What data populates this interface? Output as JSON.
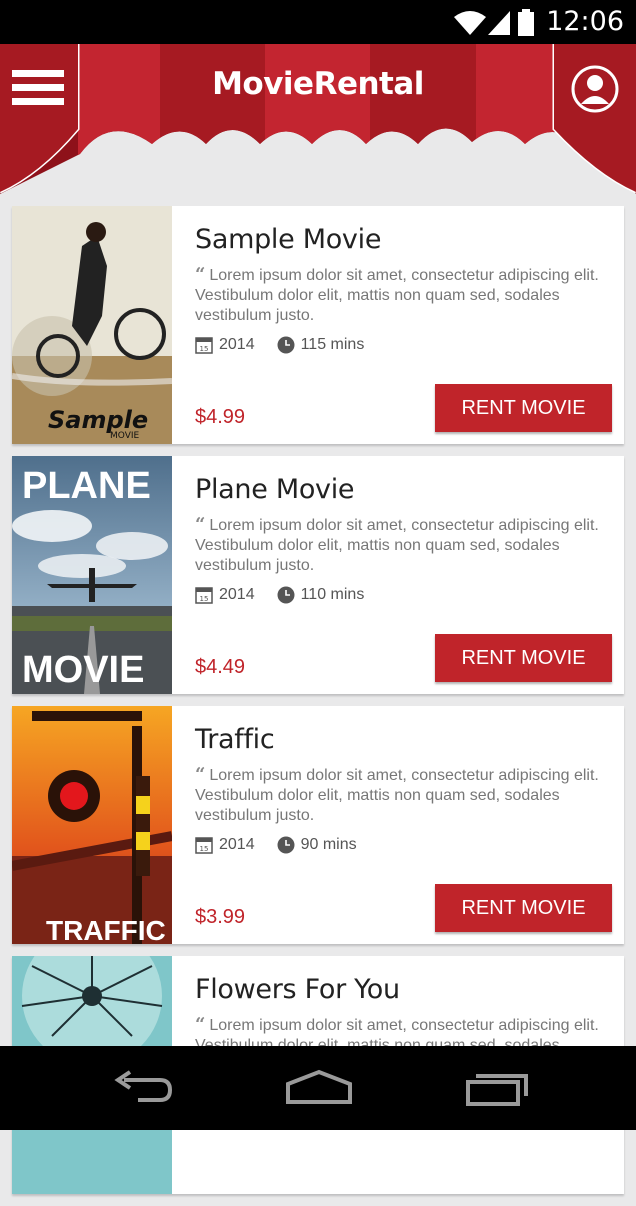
{
  "status_bar": {
    "time": "12:06"
  },
  "header": {
    "app_title": "MovieRental"
  },
  "movies": [
    {
      "title": "Sample Movie",
      "description": "Lorem ipsum dolor sit amet, consectetur adipiscing elit. Vestibulum dolor elit, mattis non quam sed, sodales vestibulum justo.",
      "year": "2014",
      "duration": "115 mins",
      "price": "$4.99",
      "button": "RENT MOVIE",
      "poster_text": "Sample",
      "poster_subtext": "MOVIE"
    },
    {
      "title": "Plane Movie",
      "description": "Lorem ipsum dolor sit amet, consectetur adipiscing elit. Vestibulum dolor elit, mattis non quam sed, sodales vestibulum justo.",
      "year": "2014",
      "duration": "110 mins",
      "price": "$4.49",
      "button": "RENT MOVIE",
      "poster_text": "PLANE",
      "poster_subtext": "MOVIE"
    },
    {
      "title": "Traffic",
      "description": "Lorem ipsum dolor sit amet, consectetur adipiscing elit. Vestibulum dolor elit, mattis non quam sed, sodales vestibulum justo.",
      "year": "2014",
      "duration": "90 mins",
      "price": "$3.99",
      "button": "RENT MOVIE",
      "poster_text": "TRAFFIC"
    },
    {
      "title": "Flowers For You",
      "description": "Lorem ipsum dolor sit amet, consectetur adipiscing elit. Vestibulum dolor elit, mattis non quam sed, sodales vestibulum justo."
    }
  ],
  "calendar_icon_text": "15",
  "colors": {
    "accent": "#c0242a",
    "header_dark": "#8e111a",
    "header_light": "#c32530",
    "background": "#e9e9ea"
  },
  "icons": {
    "menu": "hamburger-icon",
    "profile": "user-avatar-icon",
    "calendar": "calendar-icon",
    "clock": "clock-icon",
    "back": "back-icon",
    "home": "home-icon",
    "recents": "recent-apps-icon"
  }
}
